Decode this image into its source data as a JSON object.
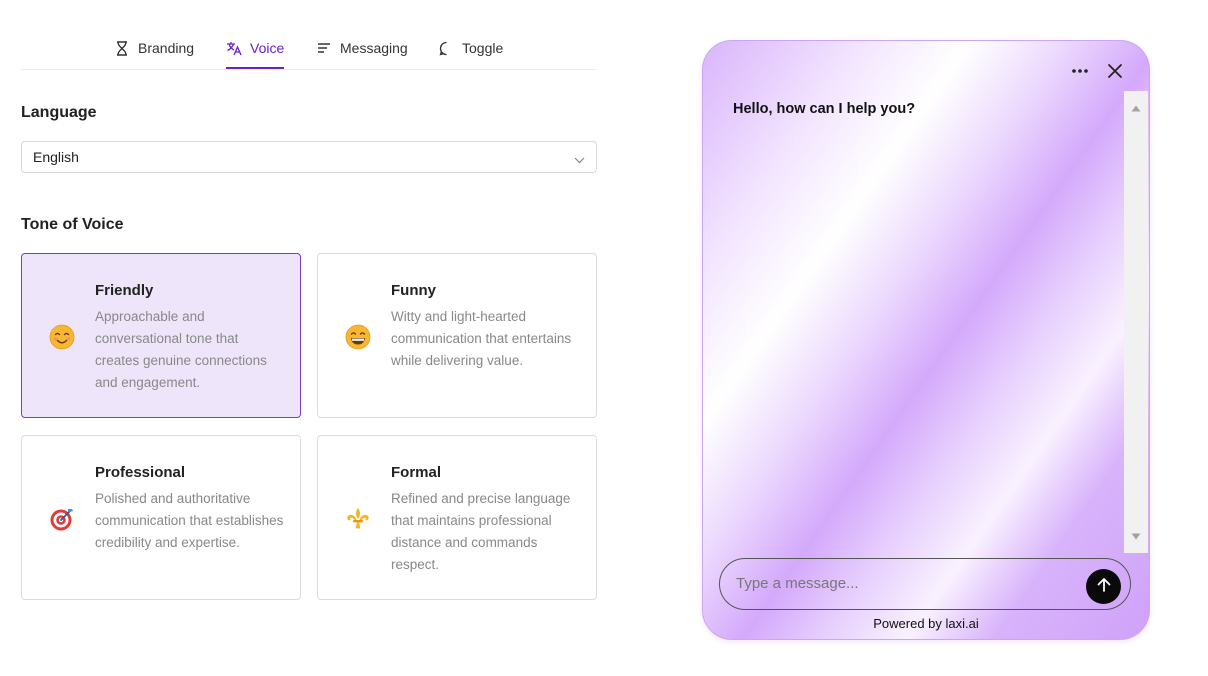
{
  "tabs": [
    {
      "label": "Branding",
      "icon": "hourglass-icon"
    },
    {
      "label": "Voice",
      "icon": "translate-icon",
      "active": true
    },
    {
      "label": "Messaging",
      "icon": "text-lines-icon"
    },
    {
      "label": "Toggle",
      "icon": "chat-bubble-icon"
    }
  ],
  "language": {
    "label": "Language",
    "selected": "English"
  },
  "tone": {
    "label": "Tone of Voice",
    "options": [
      {
        "title": "Friendly",
        "emoji": "😊",
        "icon": "smiling-face-icon",
        "description": "Approachable and conversational tone that creates genuine connections and engagement.",
        "selected": true
      },
      {
        "title": "Funny",
        "emoji": "😁",
        "icon": "grinning-face-icon",
        "description": "Witty and light-hearted communication that entertains while delivering value.",
        "selected": false
      },
      {
        "title": "Professional",
        "emoji": "🎯",
        "icon": "target-icon",
        "description": "Polished and authoritative communication that establishes credibility and expertise.",
        "selected": false
      },
      {
        "title": "Formal",
        "emoji": "⚜️",
        "icon": "fleur-de-lis-icon",
        "description": "Refined and precise language that maintains professional distance and commands respect.",
        "selected": false
      }
    ]
  },
  "chat": {
    "greeting": "Hello, how can I help you?",
    "input_placeholder": "Type a message...",
    "powered_by": "Powered by laxi.ai"
  },
  "colors": {
    "accent": "#6b21c8",
    "selected_card_bg": "#efe5fb",
    "send_button": "#0a0a0a"
  }
}
